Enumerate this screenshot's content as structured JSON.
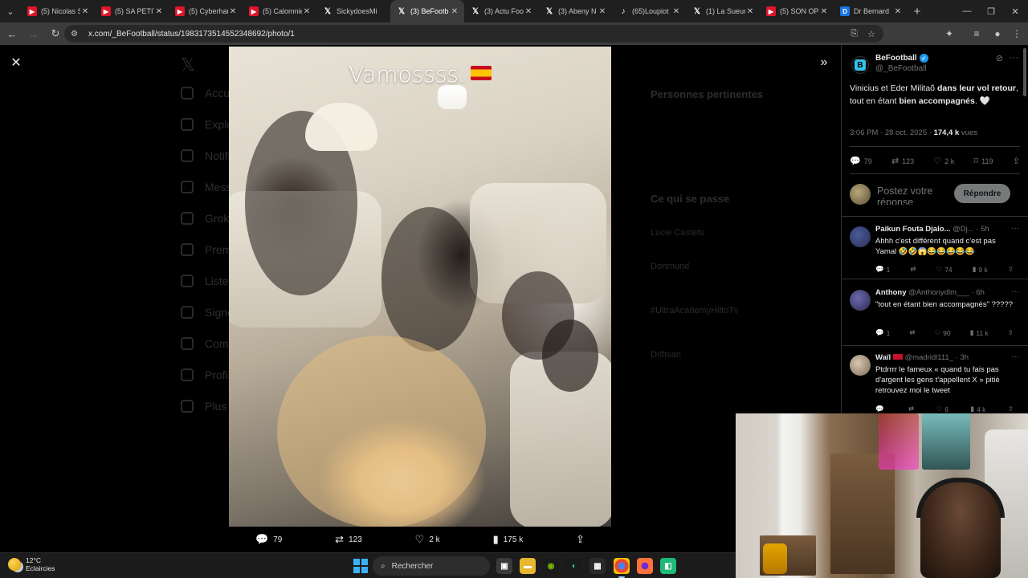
{
  "browser": {
    "tabs": [
      {
        "label": "(5) Nicolas S",
        "favicon": "youtube-icon",
        "active": false
      },
      {
        "label": "(5) SA PETIT",
        "favicon": "youtube-icon",
        "active": false
      },
      {
        "label": "(5) Cyberhar",
        "favicon": "youtube-icon",
        "active": false
      },
      {
        "label": "(5) Calomnie",
        "favicon": "youtube-icon",
        "active": false
      },
      {
        "label": "SickydoesMi",
        "favicon": "x-icon",
        "active": false
      },
      {
        "label": "(3) BeFootb",
        "favicon": "x-icon",
        "active": true
      },
      {
        "label": "(3) Actu Foo",
        "favicon": "x-icon",
        "active": false
      },
      {
        "label": "(3) Abeny N",
        "favicon": "x-icon",
        "active": false
      },
      {
        "label": "(65)Loupiot",
        "favicon": "tiktok-icon",
        "active": false
      },
      {
        "label": "(1) La Sueur",
        "favicon": "x-icon",
        "active": false
      },
      {
        "label": "(5) SON OP",
        "favicon": "youtube-icon",
        "active": false
      },
      {
        "label": "Dr Bernard",
        "favicon": "document-icon",
        "active": false
      }
    ],
    "url": "x.com/_BeFootball/status/1983173514552348692/photo/1"
  },
  "viewer": {
    "photo_caption": "Vamossss.",
    "actions": {
      "replies": "79",
      "reposts": "123",
      "likes": "2 k",
      "views": "175 k"
    }
  },
  "tweet": {
    "author_name": "BeFootball",
    "author_handle": "@_BeFootball",
    "text_part1": "Vinicius et Eder Militaõ ",
    "text_bold1": "dans leur vol retour",
    "text_part2": ", tout en étant ",
    "text_bold2": "bien accompagnés",
    "text_part3": ". ",
    "meta_time": "3:06 PM · 28 oct. 2025 · ",
    "meta_views_num": "174,4 k",
    "meta_views_label": " vues",
    "stats": {
      "replies": "79",
      "reposts": "123",
      "likes": "2 k",
      "bookmarks": "119"
    },
    "reply_placeholder": "Postez votre réponse",
    "reply_button": "Répondre"
  },
  "replies": [
    {
      "name": "Paikun Fouta Djalo...",
      "handle": "@Dj...",
      "time": "· 5h",
      "text": "Ahhh c'est différent quand c'est pas Yamal 🤣🤣😱😂😂😂😂😂",
      "replies": "1",
      "likes": "74",
      "views": "9 k"
    },
    {
      "name": "Anthony",
      "handle": "@Anthonydlm___",
      "time": "· 6h",
      "text": "\"tout en étant bien accompagnés\" ?????",
      "replies": "1",
      "likes": "90",
      "views": "11 k"
    },
    {
      "name": "Waïl",
      "handle": "@madridl111_",
      "time": "· 3h",
      "text": "Ptdrrrr le fameux « quand tu fais pas d'argent les gens t'appellent X » pitié retrouvez moi le tweet",
      "replies": "",
      "likes": "6",
      "views": "4 k"
    }
  ],
  "background_nav": [
    "Accueil",
    "Explorer",
    "Notifications",
    "Messages",
    "Grok",
    "Premium",
    "Listes",
    "Signets",
    "Communautés",
    "Profil",
    "Plus"
  ],
  "background_sidebar": {
    "relevant_title": "Personnes pertinentes",
    "trending_title": "Ce qui se passe",
    "trends": [
      "Lucie Castets",
      "Dortmund",
      "#UltraAcademyHiltoTv",
      "Driftsan"
    ]
  },
  "taskbar": {
    "temperature": "12°C",
    "weather": "Eclaircies",
    "search_label": "Rechercher"
  },
  "colors": {
    "x_blue": "#1d9bf0",
    "chrome_dark": "#1f1f1f",
    "text_secondary": "#71767b"
  }
}
